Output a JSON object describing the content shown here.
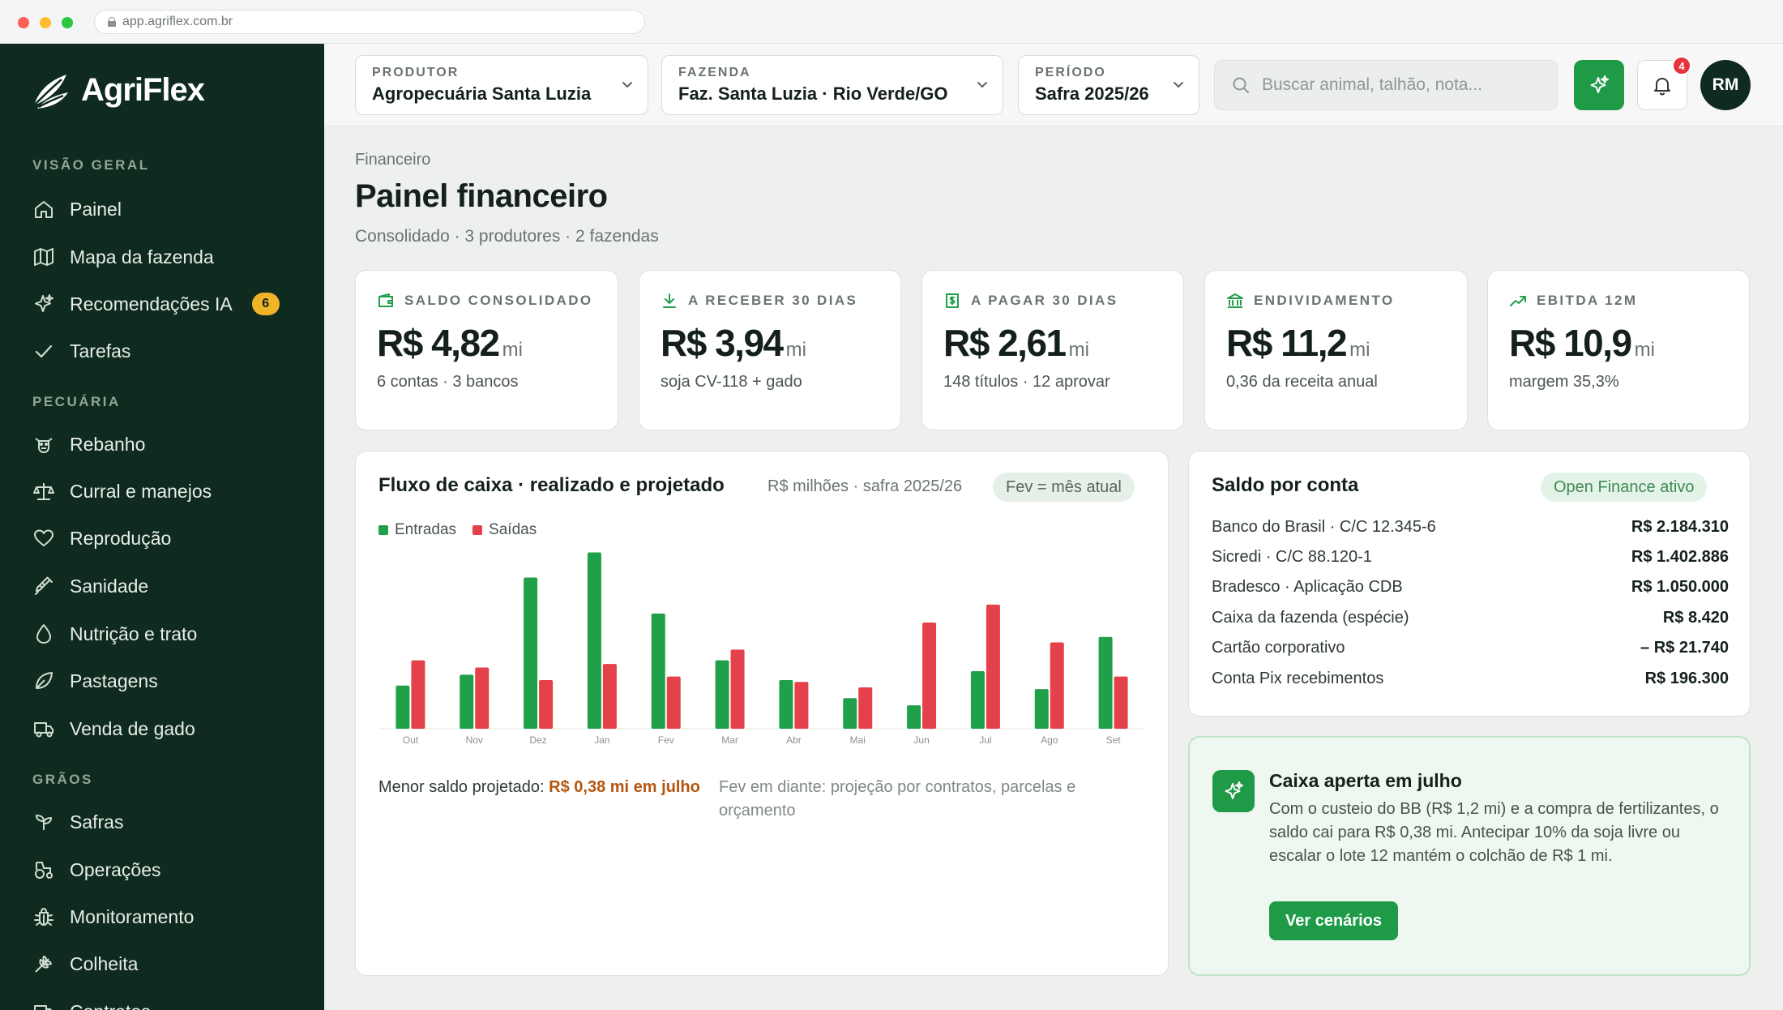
{
  "browser": {
    "url": "app.agriflex.com.br"
  },
  "brand": {
    "name": "AgriFlex"
  },
  "sidebar": {
    "sections": [
      {
        "title": "VISÃO GERAL"
      },
      {
        "title": "PECUÁRIA"
      },
      {
        "title": "GRÃOS"
      }
    ],
    "items": [
      {
        "label": "Painel",
        "icon": "home-icon"
      },
      {
        "label": "Mapa da fazenda",
        "icon": "map-icon"
      },
      {
        "label": "Recomendações IA",
        "icon": "sparkles-icon",
        "badge": "6"
      },
      {
        "label": "Tarefas",
        "icon": "check-icon"
      },
      {
        "label": "Rebanho",
        "icon": "cow-icon"
      },
      {
        "label": "Curral e manejos",
        "icon": "scale-icon"
      },
      {
        "label": "Reprodução",
        "icon": "heart-icon"
      },
      {
        "label": "Sanidade",
        "icon": "syringe-icon"
      },
      {
        "label": "Nutrição e trato",
        "icon": "drop-icon"
      },
      {
        "label": "Pastagens",
        "icon": "leaf-icon"
      },
      {
        "label": "Venda de gado",
        "icon": "truck-icon"
      },
      {
        "label": "Safras",
        "icon": "sprout-icon"
      },
      {
        "label": "Operações",
        "icon": "tractor-icon"
      },
      {
        "label": "Monitoramento",
        "icon": "bug-icon"
      },
      {
        "label": "Colheita",
        "icon": "wheat-icon"
      },
      {
        "label": "Contratos",
        "icon": "contract-icon"
      }
    ]
  },
  "topbar": {
    "producer": {
      "label": "PRODUTOR",
      "value": "Agropecuária Santa Luzia"
    },
    "farm": {
      "label": "FAZENDA",
      "value": "Faz. Santa Luzia · Rio Verde/GO"
    },
    "period": {
      "label": "PERÍODO",
      "value": "Safra 2025/26"
    },
    "search_placeholder": "Buscar animal, talhão, nota...",
    "notifications": "4",
    "avatar": "RM"
  },
  "page": {
    "breadcrumb": "Financeiro",
    "title": "Painel financeiro",
    "subtitle": "Consolidado · 3 produtores · 2 fazendas"
  },
  "kpis": [
    {
      "label": "SALDO CONSOLIDADO",
      "value": "R$ 4,82",
      "unit": "mi",
      "sub": "6 contas · 3 bancos",
      "icon": "wallet-icon"
    },
    {
      "label": "A RECEBER 30 DIAS",
      "value": "R$ 3,94",
      "unit": "mi",
      "sub": "soja CV-118 + gado",
      "icon": "download-icon"
    },
    {
      "label": "A PAGAR 30 DIAS",
      "value": "R$ 2,61",
      "unit": "mi",
      "sub": "148 títulos · 12 aprovar",
      "icon": "bill-icon"
    },
    {
      "label": "ENDIVIDAMENTO",
      "value": "R$ 11,2",
      "unit": "mi",
      "sub": "0,36 da receita anual",
      "icon": "bank-icon"
    },
    {
      "label": "EBITDA 12M",
      "value": "R$ 10,9",
      "unit": "mi",
      "sub": "margem 35,3%",
      "icon": "trend-up-icon"
    }
  ],
  "cashflow": {
    "title": "Fluxo de caixa · realizado e projetado",
    "meta": "R$ milhões · safra 2025/26",
    "pill": "Fev = mês atual",
    "footer_text": "Menor saldo projetado: ",
    "footer_highlight": "R$ 0,38 mi em julho",
    "note": "Fev em diante: projeção por contratos, parcelas e orçamento"
  },
  "chart_data": {
    "type": "bar",
    "categories": [
      "Out",
      "Nov",
      "Dez",
      "Jan",
      "Fev",
      "Mar",
      "Abr",
      "Mai",
      "Jun",
      "Jul",
      "Ago",
      "Set"
    ],
    "series": [
      {
        "name": "Entradas",
        "color": "#21a04a",
        "values": [
          1.2,
          1.5,
          4.2,
          4.9,
          3.2,
          1.9,
          1.35,
          0.85,
          0.65,
          1.6,
          1.1,
          2.55
        ]
      },
      {
        "name": "Saídas",
        "color": "#e5414a",
        "values": [
          1.9,
          1.7,
          1.35,
          1.8,
          1.45,
          2.2,
          1.3,
          1.15,
          2.95,
          3.45,
          2.4,
          1.45
        ]
      }
    ],
    "ylim": [
      0,
      5
    ],
    "grid": false,
    "legend": "top-left"
  },
  "accounts": {
    "title": "Saldo por conta",
    "pill": "Open Finance ativo",
    "rows": [
      {
        "name": "Banco do Brasil · C/C 12.345-6",
        "value": "R$ 2.184.310"
      },
      {
        "name": "Sicredi · C/C 88.120-1",
        "value": "R$ 1.402.886"
      },
      {
        "name": "Bradesco · Aplicação CDB",
        "value": "R$ 1.050.000"
      },
      {
        "name": "Caixa da fazenda (espécie)",
        "value": "R$ 8.420"
      },
      {
        "name": "Cartão corporativo",
        "value": "– R$ 21.740"
      },
      {
        "name": "Conta Pix recebimentos",
        "value": "R$ 196.300"
      }
    ]
  },
  "insight": {
    "title": "Caixa aperta em julho",
    "body": "Com o custeio do BB (R$ 1,2 mi) e a compra de fertilizantes, o saldo cai para R$ 0,38 mi. Antecipar 10% da soja livre ou escalar o lote 12 mantém o colchão de R$ 1 mi.",
    "button": "Ver cenários"
  }
}
